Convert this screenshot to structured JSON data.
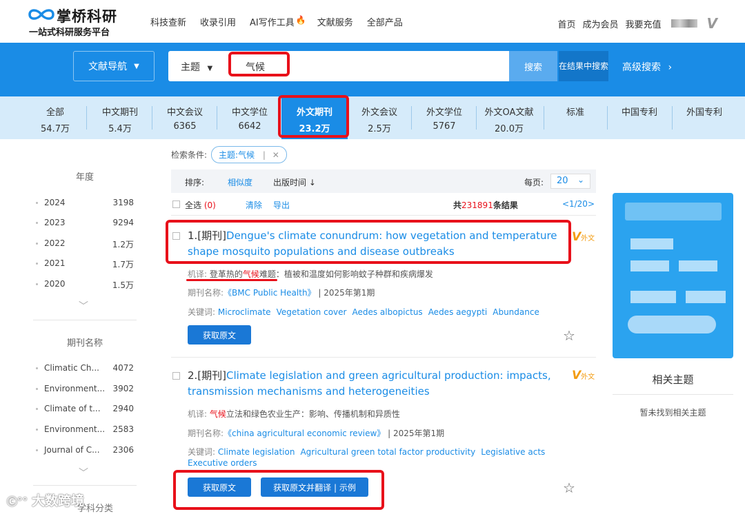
{
  "brand": {
    "name": "掌桥科研",
    "tagline": "一站式科研服务平台"
  },
  "topnav": {
    "links": [
      "科技查新",
      "收录引用",
      "AI写作工具",
      "文献服务",
      "全部产品"
    ],
    "right": [
      "首页",
      "成为会员",
      "我要充值"
    ]
  },
  "search": {
    "doc_nav_label": "文献导航",
    "field": "主题",
    "query": "气候",
    "search_button": "搜索",
    "within_line1": "在结果",
    "within_line2": "中搜索",
    "advanced": "高级搜索"
  },
  "categories": [
    {
      "label": "全部",
      "count": "54.7万"
    },
    {
      "label": "中文期刊",
      "count": "5.4万"
    },
    {
      "label": "中文会议",
      "count": "6365"
    },
    {
      "label": "中文学位",
      "count": "6642"
    },
    {
      "label": "外文期刊",
      "count": "23.2万"
    },
    {
      "label": "外文会议",
      "count": "2.5万"
    },
    {
      "label": "外文学位",
      "count": "5767"
    },
    {
      "label": "外文OA文献",
      "count": "20.0万"
    },
    {
      "label": "标准",
      "count": ""
    },
    {
      "label": "中国专利",
      "count": ""
    },
    {
      "label": "外国专利",
      "count": ""
    }
  ],
  "sidebar": {
    "year_title": "年度",
    "years": [
      {
        "name": "2024",
        "count": "3198"
      },
      {
        "name": "2023",
        "count": "9294"
      },
      {
        "name": "2022",
        "count": "1.2万"
      },
      {
        "name": "2021",
        "count": "1.7万"
      },
      {
        "name": "2020",
        "count": "1.5万"
      }
    ],
    "journal_title": "期刊名称",
    "journals": [
      {
        "name": "Climatic Ch...",
        "count": "4072"
      },
      {
        "name": "Environment...",
        "count": "3902"
      },
      {
        "name": "Climate of t...",
        "count": "2940"
      },
      {
        "name": "Environment...",
        "count": "2583"
      },
      {
        "name": "Journal of C...",
        "count": "2306"
      }
    ],
    "bottom_label": "学科分类"
  },
  "conditions": {
    "label": "检索条件:",
    "tag": "主题:气候",
    "sep": "|"
  },
  "sort": {
    "label": "排序:",
    "relevance": "相似度",
    "pub_time": "出版时间 ↓",
    "per_page_label": "每页:",
    "per_page": "20"
  },
  "selection": {
    "select_all": "全选",
    "selected": "(0)",
    "clear": "清除",
    "export": "导出",
    "total_prefix": "共",
    "total": "231891",
    "total_suffix": "条结果",
    "page": "<1/20>"
  },
  "results": [
    {
      "prefix": "1.[期刊]",
      "title": "Dengue's climate conundrum: how vegetation and temperature shape mosquito populations and disease outbreaks",
      "tr_label": "机译:",
      "tr_a": "登革热的",
      "tr_hl": "气候",
      "tr_b": "难题：植被和温度如何影响蚊子种群和疾病爆发",
      "journal_label": "期刊名称:",
      "journal": "《BMC Public Health》",
      "issue": "| 2025年第1期",
      "kw_label": "关键词:",
      "keywords": [
        "Microclimate",
        "Vegetation cover",
        "Aedes albopictus",
        "Aedes aegypti",
        "Abundance"
      ],
      "lang_tag": "外文",
      "btn_fulltext": "获取原文"
    },
    {
      "prefix": "2.[期刊]",
      "title": "Climate legislation and green agricultural production: impacts, transmission mechanisms and heterogeneities",
      "tr_label": "机译:",
      "tr_a": "",
      "tr_hl": "气候",
      "tr_b": "立法和绿色农业生产：影响、传播机制和异质性",
      "journal_label": "期刊名称:",
      "journal": "《china agricultural economic review》",
      "issue": "| 2025年第1期",
      "kw_label": "关键词:",
      "keywords": [
        "Climate legislation",
        "Agricultural green total factor productivity",
        "Legislative acts"
      ],
      "keywords_line2": "Executive orders",
      "lang_tag": "外文",
      "btn_fulltext": "获取原文",
      "btn_translate": "获取原文并翻译 | 示例"
    }
  ],
  "right_panel": {
    "related_title": "相关主题",
    "related_empty": "暂未找到相关主题"
  },
  "watermark": "大数跨境",
  "colors": {
    "brand_blue": "#1a8ce6",
    "highlight_red": "#e8101a",
    "tab_bg": "#d6ebfa"
  }
}
